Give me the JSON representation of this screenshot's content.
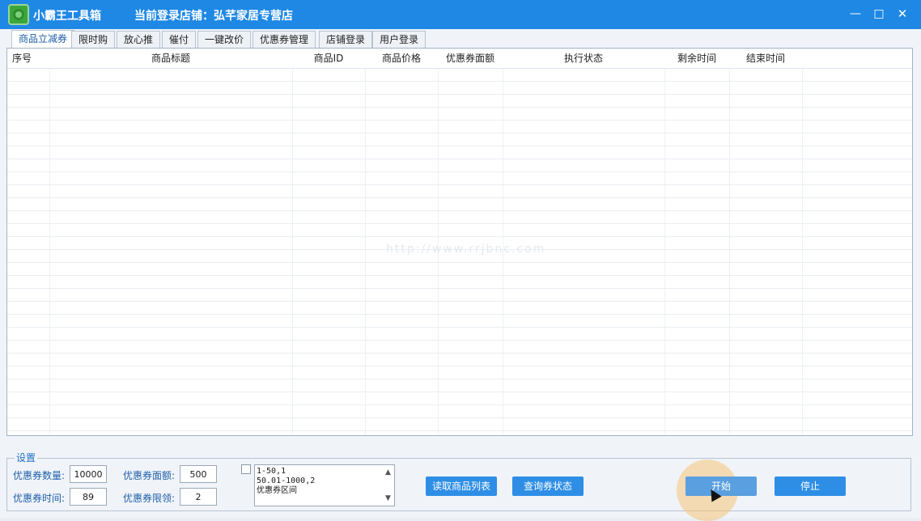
{
  "titlebar": {
    "app_name": "小霸王工具箱",
    "store_label": "当前登录店铺：弘芊家居专营店",
    "minimize_glyph": "—",
    "maximize_glyph": "□",
    "close_glyph": "✕"
  },
  "tabs": [
    {
      "label": "商品立减券",
      "active": true
    },
    {
      "label": "限时购",
      "active": false
    },
    {
      "label": "放心推",
      "active": false
    },
    {
      "label": "催付",
      "active": false
    },
    {
      "label": "一键改价",
      "active": false
    },
    {
      "label": "优惠券管理",
      "active": false
    },
    {
      "label": "店铺登录",
      "active": false
    },
    {
      "label": "用户登录",
      "active": false
    }
  ],
  "table": {
    "columns": [
      "序号",
      "商品标题",
      "商品ID",
      "商品价格",
      "优惠券面额",
      "执行状态",
      "剩余时间",
      "结束时间"
    ],
    "rows": []
  },
  "watermark": "http://www.rrjbnc.com",
  "settings": {
    "legend": "设置",
    "coupon_count_label": "优惠券数量:",
    "coupon_count_value": "10000",
    "coupon_time_label": "优惠券时间:",
    "coupon_time_value": "89",
    "coupon_amount_label": "优惠券面额:",
    "coupon_amount_value": "500",
    "coupon_limit_label": "优惠券限领:",
    "coupon_limit_value": "2",
    "range_text": "1-50,1\n50.01-1000,2\n优惠券区间",
    "range_checked": false
  },
  "buttons": {
    "read_list": "读取商品列表",
    "query_status": "查询券状态",
    "start": "开始",
    "stop": "停止"
  },
  "colors": {
    "titlebar": "#1f88e5",
    "button": "#2e8ee6",
    "accent_text": "#1f5fa8"
  }
}
